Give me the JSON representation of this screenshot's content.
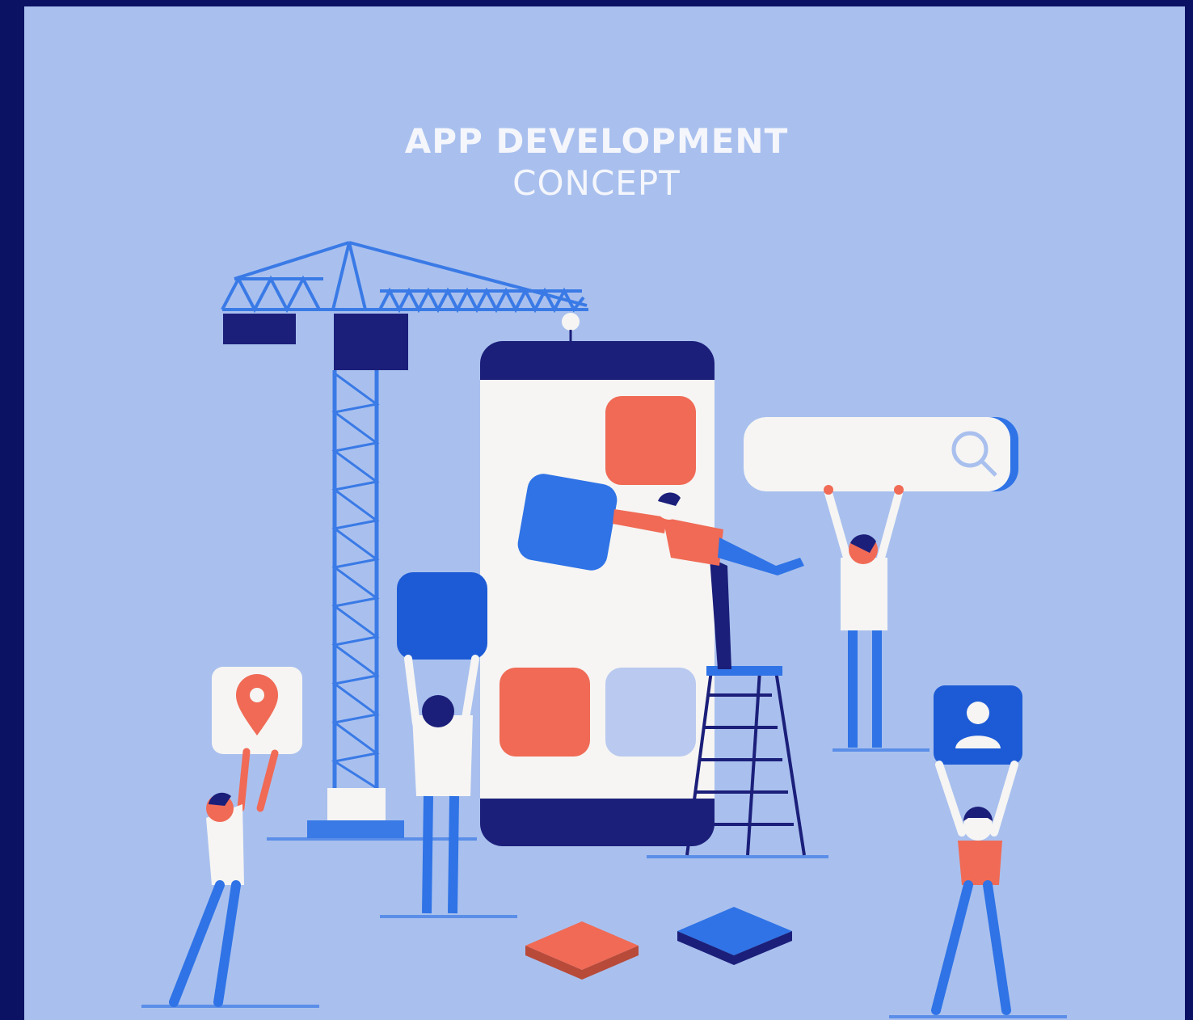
{
  "title": {
    "line1": "APP DEVELOPMENT",
    "line2": "CONCEPT"
  },
  "colors": {
    "frame": "#0b1263",
    "background": "#a9c0ee",
    "navy": "#1b1f7a",
    "blue": "#2f73e6",
    "deep_blue": "#1d5bd6",
    "coral": "#f06a55",
    "white": "#f6f5f3",
    "light_tile": "#b9c9ef"
  },
  "icons": [
    "location-pin-icon",
    "search-icon",
    "user-profile-icon"
  ]
}
